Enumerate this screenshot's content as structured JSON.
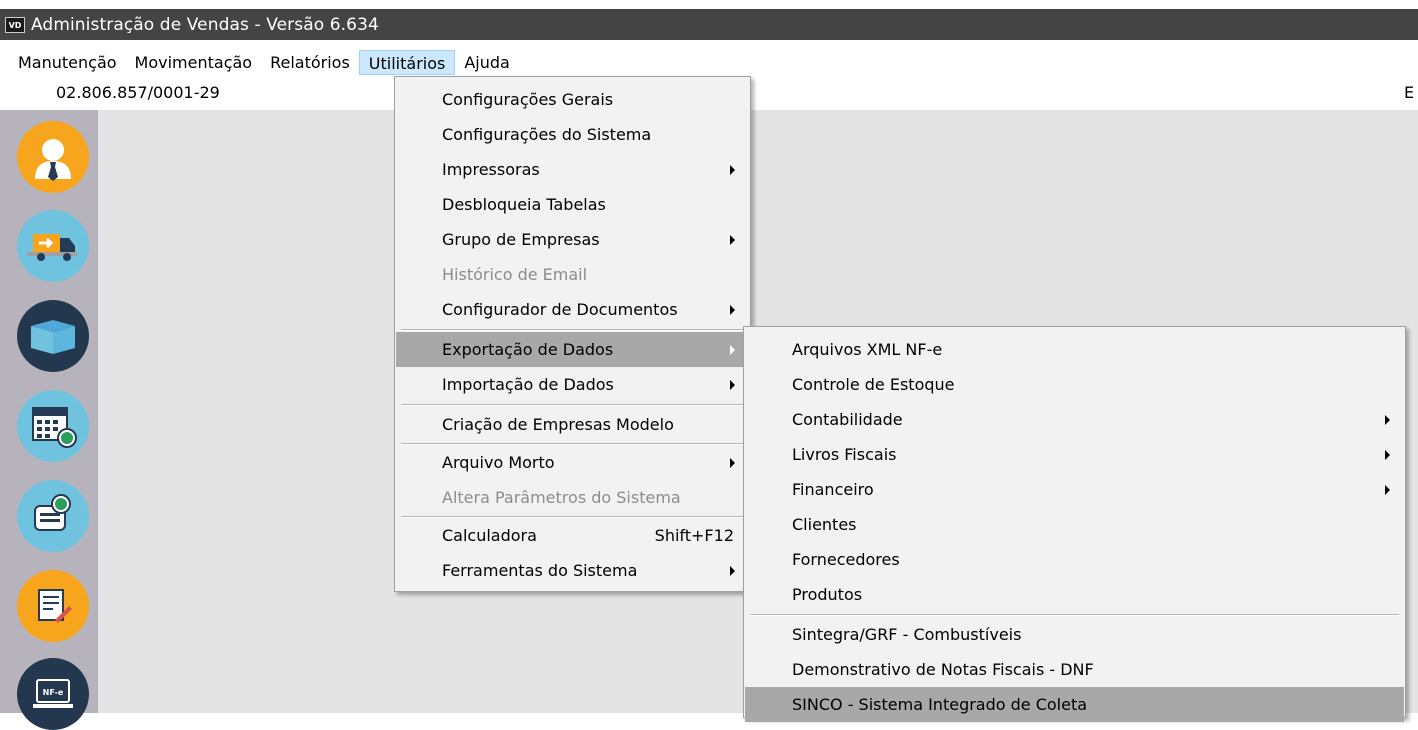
{
  "window": {
    "icon_text": "VD",
    "title": "Administração de Vendas - Versão 6.634"
  },
  "menubar": {
    "items": [
      "Manutenção",
      "Movimentação",
      "Relatórios",
      "Utilitários",
      "Ajuda"
    ],
    "active": "Utilitários"
  },
  "infobar": {
    "cnpj": "02.806.857/0001-29",
    "right_text": "E"
  },
  "sidebar": {
    "buttons": [
      {
        "name": "user-icon",
        "color": "#f7a51c"
      },
      {
        "name": "delivery-truck-icon",
        "color": "#6fc3df"
      },
      {
        "name": "box-icon",
        "color": "#23374f"
      },
      {
        "name": "calendar-money-icon",
        "color": "#6fc3df"
      },
      {
        "name": "document-money-icon",
        "color": "#6fc3df"
      },
      {
        "name": "notes-edit-icon",
        "color": "#f7a51c"
      },
      {
        "name": "nfe-computer-icon",
        "color": "#23374f"
      }
    ]
  },
  "utilitarios_menu": {
    "items": [
      {
        "label": "Configurações Gerais"
      },
      {
        "label": "Configurações do Sistema"
      },
      {
        "label": "Impressoras",
        "submenu": true
      },
      {
        "label": "Desbloqueia Tabelas"
      },
      {
        "label": "Grupo de Empresas",
        "submenu": true
      },
      {
        "label": "Histórico de Email",
        "disabled": true
      },
      {
        "label": "Configurador de Documentos",
        "submenu": true
      },
      {
        "label": "Exportação de Dados",
        "submenu": true,
        "highlighted": true
      },
      {
        "label": "Importação de Dados",
        "submenu": true
      },
      {
        "label": "Criação de Empresas Modelo"
      },
      {
        "label": "Arquivo Morto",
        "submenu": true
      },
      {
        "label": "Altera Parâmetros do Sistema",
        "disabled": true
      },
      {
        "label": "Calculadora",
        "shortcut": "Shift+F12"
      },
      {
        "label": "Ferramentas do Sistema",
        "submenu": true
      }
    ]
  },
  "exportacao_submenu": {
    "items": [
      {
        "label": "Arquivos XML NF-e"
      },
      {
        "label": "Controle de Estoque"
      },
      {
        "label": "Contabilidade",
        "submenu": true
      },
      {
        "label": "Livros Fiscais",
        "submenu": true
      },
      {
        "label": "Financeiro",
        "submenu": true
      },
      {
        "label": "Clientes"
      },
      {
        "label": "Fornecedores"
      },
      {
        "label": "Produtos"
      },
      {
        "label": "Sintegra/GRF - Combustíveis"
      },
      {
        "label": "Demonstrativo de Notas Fiscais - DNF"
      },
      {
        "label": "SINCO - Sistema Integrado de Coleta",
        "highlighted": true
      }
    ]
  },
  "colors": {
    "titlebar": "#444444",
    "sidebar": "#b6b3bd",
    "workspace": "#e4e4e4",
    "menu_bg": "#f2f2f2",
    "menu_highlight": "#a8a8a8",
    "menubar_active": "#cce8ff"
  }
}
